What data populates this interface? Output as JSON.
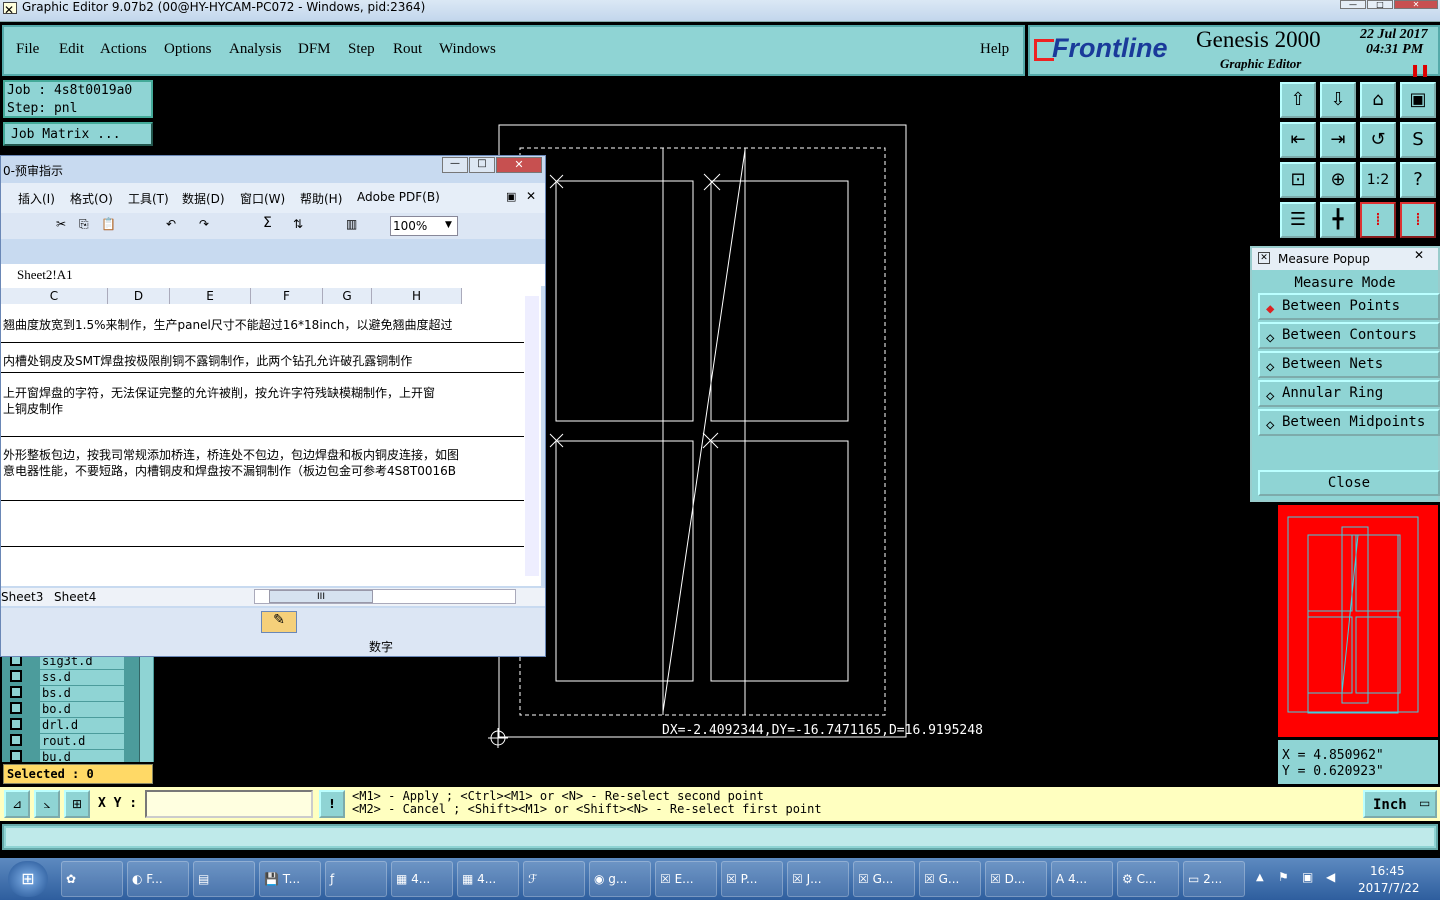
{
  "window": {
    "title": "Graphic Editor 9.07b2 (00@HY-HYCAM-PC072 - Windows, pid:2364)"
  },
  "menu": {
    "items": [
      "File",
      "Edit",
      "Actions",
      "Options",
      "Analysis",
      "DFM",
      "Step",
      "Rout",
      "Windows"
    ],
    "help": "Help"
  },
  "brand": {
    "logo": "Frontline",
    "product": "Genesis 2000",
    "subtitle": "Graphic Editor",
    "date": "22 Jul 2017",
    "time": "04:31 PM"
  },
  "job": {
    "job": "Job : 4s8t0019a0",
    "step": "Step: pnl",
    "matrix_btn": "Job Matrix ..."
  },
  "layers": [
    "sig3t.d",
    "ss.d",
    "bs.d",
    "bo.d",
    "drl.d",
    "rout.d",
    "bu.d"
  ],
  "selected": "Selected : 0",
  "excel": {
    "title": "0-预审指示",
    "menus": [
      "插入(I)",
      "格式(O)",
      "工具(T)",
      "数据(D)",
      "窗口(W)",
      "帮助(H)",
      "Adobe PDF(B)"
    ],
    "zoom": "100%",
    "namebox": "Sheet2!A1",
    "columns": [
      "C",
      "D",
      "E",
      "F",
      "G",
      "H"
    ],
    "rows": [
      "翘曲度放宽到1.5%来制作，生产panel尺寸不能超过16*18inch，以避免翘曲度超过",
      "内槽处铜皮及SMT焊盘按极限削铜不露铜制作，此两个钻孔允许破孔露铜制作",
      "上开窗焊盘的字符，无法保证完整的允许被削，按允许字符残缺模糊制作，上开窗",
      "上铜皮制作",
      "外形整板包边，按我司常规添加桥连，桥连处不包边，包边焊盘和板内铜皮连接，如图",
      "意电器性能，不要短路，内槽铜皮和焊盘按不漏铜制作（板边包金可参考4S8T0016B"
    ],
    "sheets": [
      "Sheet3",
      "Sheet4"
    ],
    "scroll_label": "III",
    "status_num": "数字"
  },
  "measure": {
    "title": "Measure Popup",
    "header": "Measure Mode",
    "options": [
      "Between Points",
      "Between Contours",
      "Between Nets",
      "Annular Ring",
      "Between Midpoints"
    ],
    "selected_option": "Between Points",
    "close": "Close"
  },
  "readout": {
    "dxdy": "DX=-2.4092344,DY=-16.7471165,D=16.9195248",
    "x": "X = 4.850962\"",
    "y": "Y = 0.620923\""
  },
  "bottom": {
    "xy_label": "X Y :",
    "hint1": "<M1> - Apply  ; <Ctrl><M1> or <N> - Re-select second point",
    "hint2": "<M2> - Cancel ; <Shift><M1> or <Shift><N> - Re-select first point",
    "units": "Inch"
  },
  "taskbar": {
    "items": [
      "F...",
      "",
      "T...",
      "",
      "4...",
      "4...",
      "",
      "g...",
      "E...",
      "P...",
      "J...",
      "G...",
      "G...",
      "D...",
      "4...",
      "C...",
      "2..."
    ],
    "time": "16:45",
    "date": "2017/7/22"
  },
  "colors": {
    "panel": "#8fd4d4",
    "canvas": "#000000",
    "preview": "#ff0000",
    "status": "#ffffc0"
  }
}
